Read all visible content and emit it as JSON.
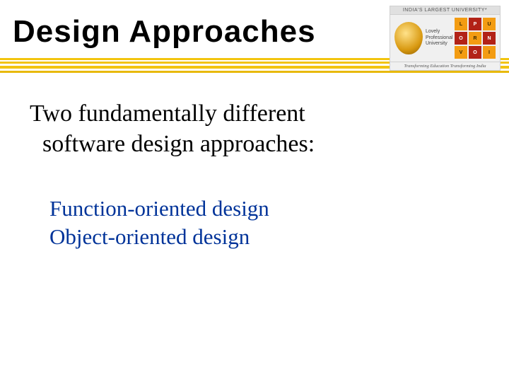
{
  "title": "Design  Approaches",
  "logo": {
    "topbar": "INDIA'S LARGEST UNIVERSITY*",
    "name": "Lovely Professional University",
    "grid": [
      "L",
      "P",
      "U",
      "O",
      "R",
      "N",
      "V",
      "O",
      "I"
    ],
    "tagline": "Transforming Education Transforming India"
  },
  "intro_line1": "Two fundamentally different",
  "intro_line2": "software design approaches:",
  "approaches": {
    "a1": "Function-oriented design",
    "a2": "Object-oriented design"
  }
}
